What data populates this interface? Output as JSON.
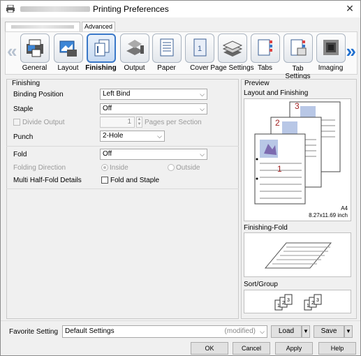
{
  "window": {
    "title": "Printing Preferences",
    "close_glyph": "✕"
  },
  "tabs": [
    {
      "label": ""
    },
    {
      "label": "Advanced"
    }
  ],
  "ribbon": {
    "items": [
      {
        "label": "General",
        "icon": "printer-icon"
      },
      {
        "label": "Layout",
        "icon": "layout-icon"
      },
      {
        "label": "Finishing",
        "icon": "finishing-icon",
        "selected": true
      },
      {
        "label": "Output",
        "icon": "output-icon"
      },
      {
        "label": "Paper",
        "icon": "paper-icon"
      },
      {
        "label": "Cover",
        "icon": "cover-icon"
      },
      {
        "label": "Page Settings",
        "icon": "page-settings-icon"
      },
      {
        "label": "Tabs",
        "icon": "tabs-icon"
      },
      {
        "label": "Tab\nSettings",
        "icon": "tab-settings-icon"
      },
      {
        "label": "Imaging",
        "icon": "imaging-icon"
      }
    ]
  },
  "finishing": {
    "section_title": "Finishing",
    "binding_position": {
      "label": "Binding Position",
      "value": "Left Bind"
    },
    "staple": {
      "label": "Staple",
      "value": "Off"
    },
    "divide_output": {
      "label": "Divide Output",
      "checked": false,
      "disabled": true,
      "count": "1",
      "suffix": "Pages per Section"
    },
    "punch": {
      "label": "Punch",
      "value": "2-Hole"
    },
    "fold": {
      "label": "Fold",
      "value": "Off"
    },
    "folding_direction": {
      "label": "Folding Direction",
      "options": [
        "Inside",
        "Outside"
      ],
      "selected": "Inside",
      "disabled": true
    },
    "multi_half_fold": {
      "label": "Multi Half-Fold Details",
      "checkbox_label": "Fold and Staple",
      "checked": false
    }
  },
  "preview": {
    "section_title": "Preview",
    "layout_title": "Layout and Finishing",
    "page_numbers": [
      "1",
      "2",
      "3"
    ],
    "paper_size": "A4",
    "paper_dims": "8.27x11.69 inch",
    "fold_title": "Finishing-Fold",
    "sort_title": "Sort/Group"
  },
  "favorite": {
    "label": "Favorite Setting",
    "value": "Default Settings",
    "modified": "(modified)",
    "load": "Load",
    "save": "Save"
  },
  "buttons": {
    "ok": "OK",
    "cancel": "Cancel",
    "apply": "Apply",
    "help": "Help"
  }
}
